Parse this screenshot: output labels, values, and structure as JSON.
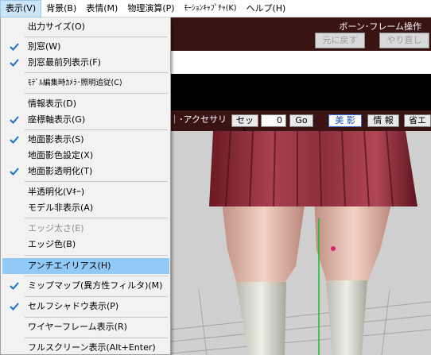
{
  "menubar": {
    "items": [
      {
        "label": "表示(V)"
      },
      {
        "label": "背景(B)"
      },
      {
        "label": "表情(M)"
      },
      {
        "label": "物理演算(P)"
      },
      {
        "label": "ﾓｰｼｮﾝｷｬﾌﾟﾁｬ(K)"
      },
      {
        "label": "ヘルプ(H)"
      }
    ]
  },
  "header": {
    "title": "ボーン･フレーム操作",
    "undo": "元に戻す",
    "redo": "やり直し"
  },
  "toolbar": {
    "accessory_label": "｜･アクセサリ",
    "set_label": "セット",
    "frame_value": "0",
    "go_label": "Go",
    "beauty_shadow": "美 影",
    "info": "情 報",
    "energy_saving": "省エ"
  },
  "menu": {
    "items": [
      {
        "label": "出力サイズ(O)",
        "checked": false,
        "disabled": false
      },
      {
        "label": "別窓(W)",
        "checked": true,
        "disabled": false
      },
      {
        "label": "別窓最前列表示(F)",
        "checked": true,
        "disabled": false
      },
      {
        "label": "ﾓﾃﾞﾙ編集時ｶﾒﾗ･照明追従(C)",
        "checked": false,
        "disabled": false
      },
      {
        "label": "情報表示(D)",
        "checked": false,
        "disabled": false
      },
      {
        "label": "座標軸表示(G)",
        "checked": true,
        "disabled": false
      },
      {
        "label": "地面影表示(S)",
        "checked": true,
        "disabled": false
      },
      {
        "label": "地面影色設定(X)",
        "checked": false,
        "disabled": false
      },
      {
        "label": "地面影透明化(T)",
        "checked": true,
        "disabled": false
      },
      {
        "label": "半透明化(Vｷｰ)",
        "checked": false,
        "disabled": false
      },
      {
        "label": "モデル非表示(A)",
        "checked": false,
        "disabled": false
      },
      {
        "label": "エッジ太さ(E)",
        "checked": false,
        "disabled": true
      },
      {
        "label": "エッジ色(B)",
        "checked": false,
        "disabled": false
      },
      {
        "label": "アンチエイリアス(H)",
        "checked": false,
        "disabled": false
      },
      {
        "label": "ミップマップ(異方性フィルタ)(M)",
        "checked": true,
        "disabled": false
      },
      {
        "label": "セルフシャドウ表示(P)",
        "checked": true,
        "disabled": false
      },
      {
        "label": "ワイヤーフレーム表示(R)",
        "checked": false,
        "disabled": false
      },
      {
        "label": "フルスクリーン表示(Alt+Enter)",
        "checked": false,
        "disabled": false
      }
    ]
  },
  "colors": {
    "menu_highlight": "#91c9f7",
    "check_mark": "#1a6fd4",
    "title_bar": "#3a1313"
  }
}
